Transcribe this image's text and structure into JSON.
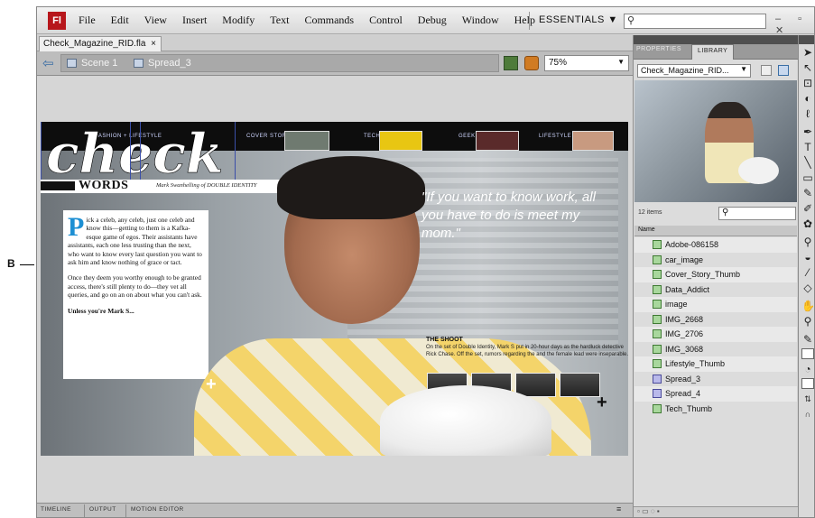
{
  "callout": {
    "letter": "B"
  },
  "menubar": {
    "logo": "Fl",
    "items": [
      "File",
      "Edit",
      "View",
      "Insert",
      "Modify",
      "Text",
      "Commands",
      "Control",
      "Debug",
      "Window",
      "Help"
    ],
    "workspace": "ESSENTIALS ▼",
    "window_controls": "– ▫ ✕"
  },
  "document": {
    "tab_label": "Check_Magazine_RID.fla",
    "close": "×",
    "breadcrumbs": [
      "Scene 1",
      "Spread_3"
    ],
    "zoom": "75%"
  },
  "artwork": {
    "logo_text": "check",
    "nav": [
      "FASHION + LIFESTYLE",
      "COVER STORY",
      "TECH",
      "GEEK",
      "LIFESTYLE"
    ],
    "words_title": "WORDS",
    "words_sub": "Mark Swanhelling of DOUBLE IDENTITY",
    "dropcap": "P",
    "para1": "ick a celeb, any celeb, just one celeb and know this—getting to them is a Kafka-esque game of egos. Their assistants have assistants, each one less trusting than the next, who want to know every last question you want to ask him and know nothing of grace or tact.",
    "para2": "Once they deem you worthy enough to be granted access, there's still plenty to do—they vet all queries, and go on an on about what you can't ask.",
    "para3": "Unless you're Mark S...",
    "quote": "\"If you want to know work, all you have to do is meet my mom.\"",
    "shoot_title": "THE SHOOT",
    "shoot_text": "On the set of Double Identity, Mark S put in 20-hour days as the hardluck detective Rick Chase. Off the set, rumors regarding the and the female lead were inseparable."
  },
  "bottom_tabs": [
    "TIMELINE",
    "OUTPUT",
    "MOTION EDITOR"
  ],
  "panel": {
    "tabs": [
      "PROPERTIES",
      "LIBRARY"
    ],
    "library_select": "Check_Magazine_RID...",
    "items_count": "12 items",
    "column_header": "Name",
    "items": [
      {
        "name": "Adobe-086158",
        "kind": "bitmap"
      },
      {
        "name": "car_image",
        "kind": "bitmap"
      },
      {
        "name": "Cover_Story_Thumb",
        "kind": "bitmap"
      },
      {
        "name": "Data_Addict",
        "kind": "bitmap"
      },
      {
        "name": "image",
        "kind": "bitmap"
      },
      {
        "name": "IMG_2668",
        "kind": "bitmap"
      },
      {
        "name": "IMG_2706",
        "kind": "bitmap"
      },
      {
        "name": "IMG_3068",
        "kind": "bitmap"
      },
      {
        "name": "Lifestyle_Thumb",
        "kind": "bitmap"
      },
      {
        "name": "Spread_3",
        "kind": "movieclip"
      },
      {
        "name": "Spread_4",
        "kind": "movieclip"
      },
      {
        "name": "Tech_Thumb",
        "kind": "bitmap"
      }
    ]
  },
  "tools": [
    "selection-icon",
    "subselection-icon",
    "free-transform-icon",
    "3d-rotation-icon",
    "lasso-icon",
    "pen-icon",
    "text-icon",
    "line-icon",
    "rectangle-icon",
    "pencil-icon",
    "brush-icon",
    "deco-icon",
    "bone-icon",
    "paint-bucket-icon",
    "eyedropper-icon",
    "eraser-icon",
    "hand-icon",
    "zoom-icon"
  ],
  "colors": {
    "flash_red": "#b7161b",
    "dropcap_blue": "#1d8fd3",
    "selection_blue": "#3b4fa8"
  }
}
